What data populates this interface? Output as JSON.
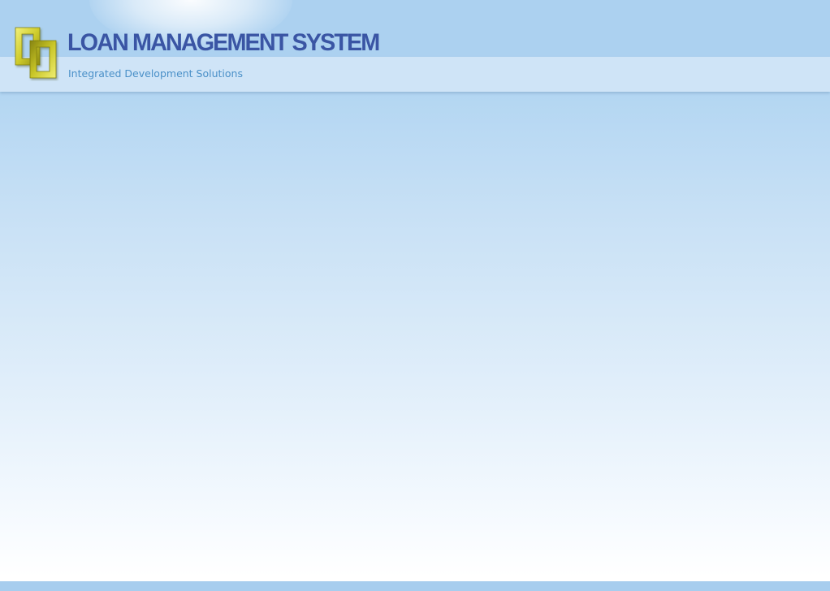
{
  "header": {
    "title": "LOAN MANAGEMENT SYSTEM",
    "subtitle": "Integrated Development Solutions",
    "logo_icon": "interlocked-frames-logo-icon"
  },
  "colors": {
    "title": "#3a55a4",
    "subtitle": "#4a90c8",
    "header_band": "#acd1f0",
    "sub_band": "#cfe4f7",
    "logo_gold": "#d4d23a",
    "footer_bar": "#a7cdee"
  }
}
